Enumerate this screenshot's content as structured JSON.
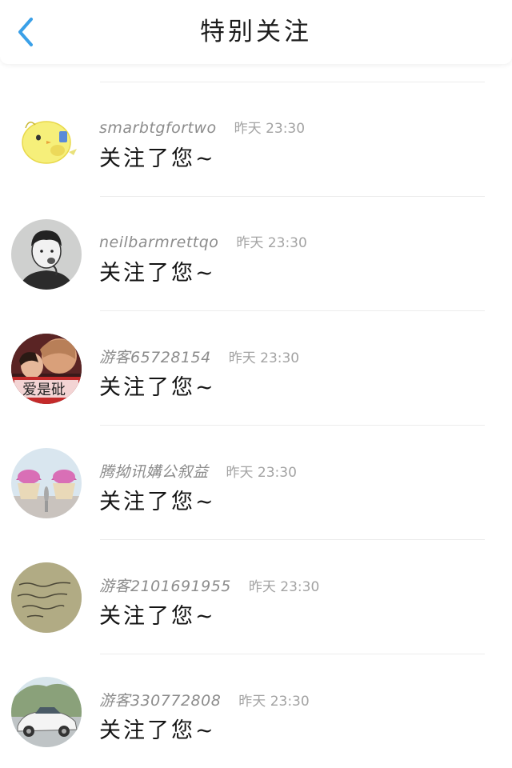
{
  "header": {
    "title": "特别关注",
    "back_icon": "chevron-left-icon",
    "accent_color": "#3aa0e8"
  },
  "notifications": [
    {
      "username": "smarbtgfortwo",
      "time": "昨天 23:30",
      "message": "关注了您~",
      "avatar": "yellow-bird-avatar"
    },
    {
      "username": "neilbarmrettqo",
      "time": "昨天 23:30",
      "message": "关注了您~",
      "avatar": "cartoon-boy-avatar"
    },
    {
      "username": "游客65728154",
      "time": "昨天 23:30",
      "message": "关注了您~",
      "avatar": "couple-photo-avatar",
      "avatar_text": "爱是砒"
    },
    {
      "username": "腾拗讯媾公叙益",
      "time": "昨天 23:30",
      "message": "关注了您~",
      "avatar": "cupcakes-avatar"
    },
    {
      "username": "游客2101691955",
      "time": "昨天 23:30",
      "message": "关注了您~",
      "avatar": "handwritten-note-avatar"
    },
    {
      "username": "游客330772808",
      "time": "昨天 23:30",
      "message": "关注了您~",
      "avatar": "white-car-avatar"
    }
  ]
}
